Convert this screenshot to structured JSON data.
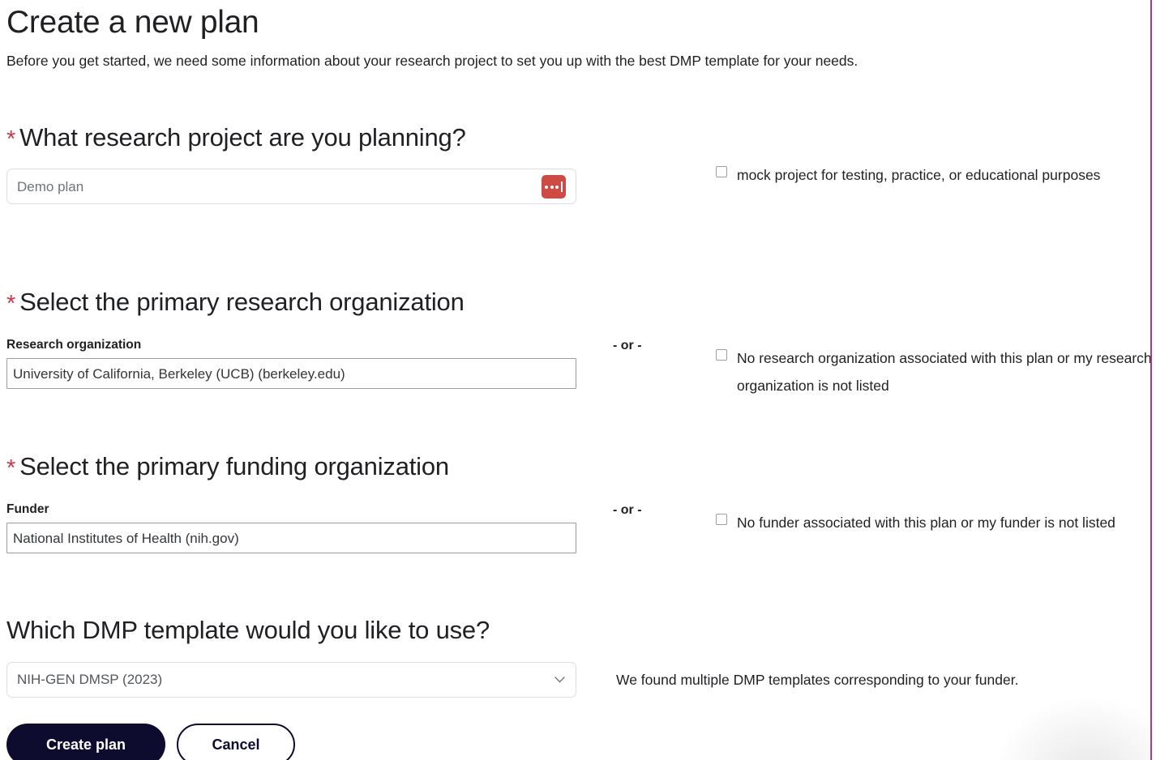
{
  "page": {
    "title": "Create a new plan",
    "intro": "Before you get started, we need some information about your research project to set you up with the best DMP template for your needs.",
    "required_marker": "*",
    "or_divider": "- or -"
  },
  "colors": {
    "required_asterisk": "#c8374a",
    "primary_button": "#0d0b2e",
    "spinner": "#cf4a43",
    "edge_rule": "#b5377f",
    "input_border": "#dcdee1",
    "autocomplete_border": "#9a9da1"
  },
  "sections": {
    "project": {
      "heading": "What research project are you planning?",
      "required": true,
      "input": {
        "name": "project-name-input",
        "value": "Demo plan",
        "placeholder": "Demo plan",
        "icon": "loading-dots-icon"
      },
      "checkbox": {
        "label": "mock project for testing, practice, or educational purposes",
        "checked": false
      }
    },
    "research_organization": {
      "heading": "Select the primary research organization",
      "required": true,
      "field_label": "Research organization",
      "input": {
        "name": "research-organization-input",
        "value": "University of California, Berkeley (UCB) (berkeley.edu)"
      },
      "checkbox": {
        "label": "No research organization associated with this plan or my research organization is not listed",
        "checked": false
      }
    },
    "funder": {
      "heading": "Select the primary funding organization",
      "required": true,
      "field_label": "Funder",
      "input": {
        "name": "funder-input",
        "value": "National Institutes of Health (nih.gov)"
      },
      "checkbox": {
        "label": "No funder associated with this plan or my funder is not listed",
        "checked": false
      }
    },
    "template": {
      "heading": "Which DMP template would you like to use?",
      "required": false,
      "select": {
        "name": "dmp-template-select",
        "value": "NIH-GEN DMSP (2023)",
        "icon": "chevron-down-icon"
      },
      "helper_text": "We found multiple DMP templates corresponding to your funder."
    }
  },
  "footer": {
    "create_label": "Create plan",
    "cancel_label": "Cancel"
  }
}
